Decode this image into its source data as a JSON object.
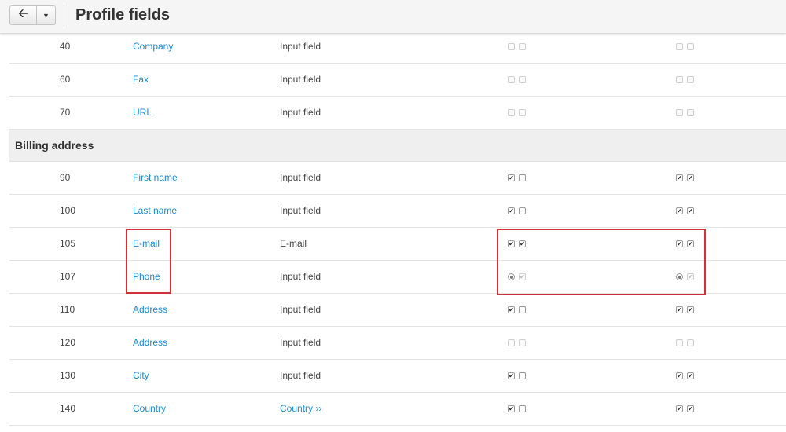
{
  "header": {
    "back_icon": "arrow-left-icon",
    "dropdown_icon": "caret-down-icon",
    "title": "Profile fields"
  },
  "rows_top": [
    {
      "position": "40",
      "name": "Company",
      "type": "Input field",
      "col1": [
        "off-dis",
        "off-dis"
      ],
      "col2": [
        "off-dis",
        "off-dis"
      ]
    },
    {
      "position": "60",
      "name": "Fax",
      "type": "Input field",
      "col1": [
        "off-dis",
        "off-dis"
      ],
      "col2": [
        "off-dis",
        "off-dis"
      ]
    },
    {
      "position": "70",
      "name": "URL",
      "type": "Input field",
      "col1": [
        "off-dis",
        "off-dis"
      ],
      "col2": [
        "off-dis",
        "off-dis"
      ]
    }
  ],
  "section": {
    "label": "Billing address"
  },
  "rows_billing": [
    {
      "position": "90",
      "name": "First name",
      "type": "Input field",
      "col1": [
        "on",
        "off"
      ],
      "col2": [
        "on",
        "on"
      ]
    },
    {
      "position": "100",
      "name": "Last name",
      "type": "Input field",
      "col1": [
        "on",
        "off"
      ],
      "col2": [
        "on",
        "on"
      ]
    },
    {
      "position": "105",
      "name": "E-mail",
      "type": "E-mail",
      "col1": [
        "on",
        "on"
      ],
      "col2": [
        "on",
        "on"
      ]
    },
    {
      "position": "107",
      "name": "Phone",
      "type": "Input field",
      "col1": [
        "radio",
        "on-dis"
      ],
      "col2": [
        "radio",
        "on-dis"
      ]
    },
    {
      "position": "110",
      "name": "Address",
      "type": "Input field",
      "col1": [
        "on",
        "off"
      ],
      "col2": [
        "on",
        "on"
      ]
    },
    {
      "position": "120",
      "name": "Address",
      "type": "Input field",
      "col1": [
        "off-dis",
        "off-dis"
      ],
      "col2": [
        "off-dis",
        "off-dis"
      ]
    },
    {
      "position": "130",
      "name": "City",
      "type": "Input field",
      "col1": [
        "on",
        "off"
      ],
      "col2": [
        "on",
        "on"
      ]
    },
    {
      "position": "140",
      "name": "Country",
      "type": "Country ››",
      "type_link": true,
      "col1": [
        "on",
        "off"
      ],
      "col2": [
        "on",
        "on"
      ]
    }
  ],
  "colors": {
    "link": "#1c8ac5",
    "highlight": "#d12f3a"
  }
}
